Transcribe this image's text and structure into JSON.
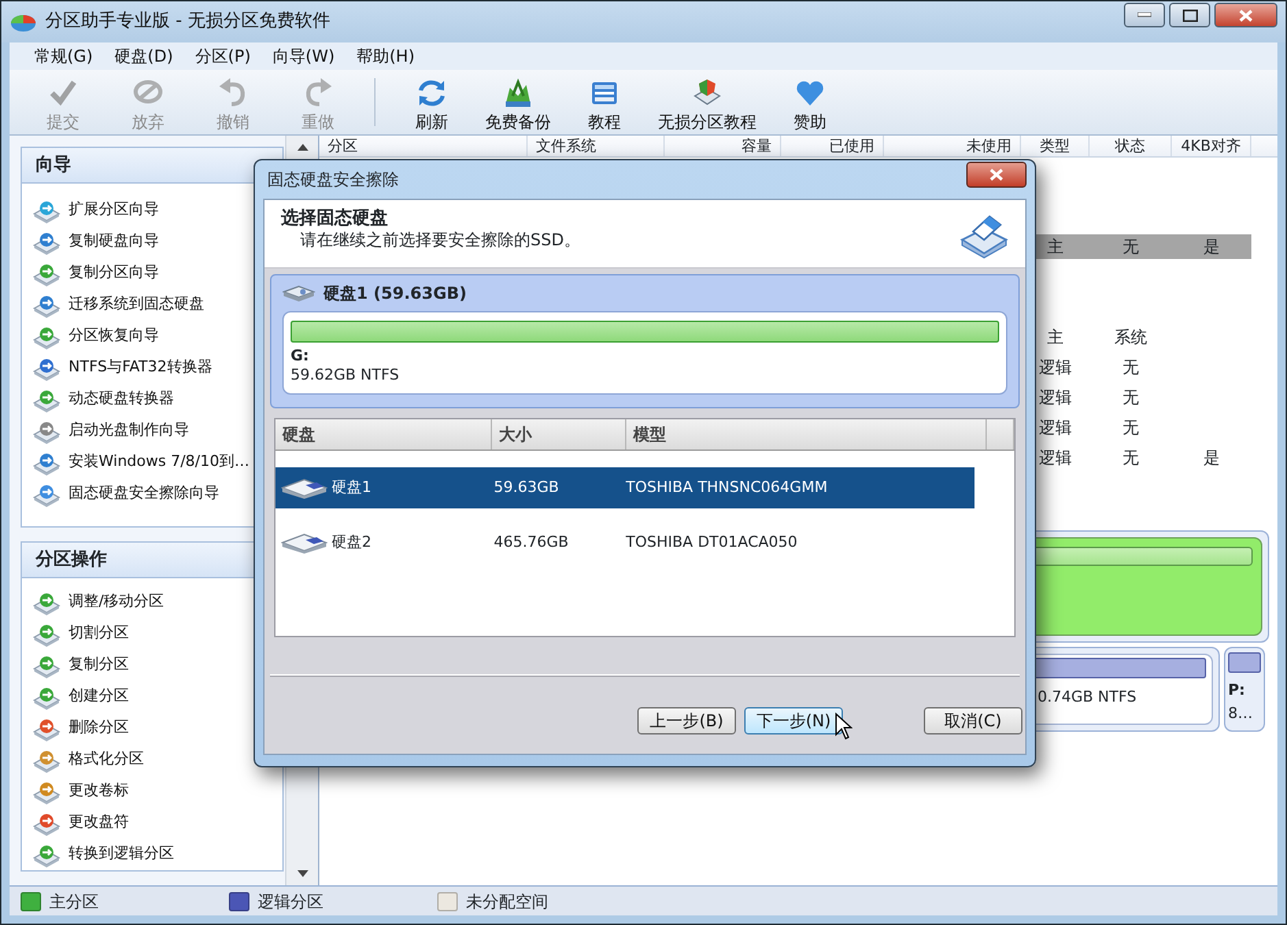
{
  "window": {
    "title": "分区助手专业版 - 无损分区免费软件"
  },
  "menu": [
    "常规(G)",
    "硬盘(D)",
    "分区(P)",
    "向导(W)",
    "帮助(H)"
  ],
  "toolbar": [
    {
      "label": "提交",
      "disabled": true
    },
    {
      "label": "放弃",
      "disabled": true
    },
    {
      "label": "撤销",
      "disabled": true
    },
    {
      "label": "重做",
      "disabled": true
    },
    {
      "label": "刷新",
      "disabled": false
    },
    {
      "label": "免费备份",
      "disabled": false
    },
    {
      "label": "教程",
      "disabled": false
    },
    {
      "label": "无损分区教程",
      "disabled": false
    },
    {
      "label": "赞助",
      "disabled": false
    }
  ],
  "sidebar": {
    "panels": [
      {
        "title": "向导",
        "items": [
          "扩展分区向导",
          "复制硬盘向导",
          "复制分区向导",
          "迁移系统到固态硬盘",
          "分区恢复向导",
          "NTFS与FAT32转换器",
          "动态硬盘转换器",
          "启动光盘制作向导",
          "安装Windows 7/8/10到…",
          "固态硬盘安全擦除向导"
        ]
      },
      {
        "title": "分区操作",
        "items": [
          "调整/移动分区",
          "切割分区",
          "复制分区",
          "创建分区",
          "删除分区",
          "格式化分区",
          "更改卷标",
          "更改盘符",
          "转换到逻辑分区"
        ]
      }
    ]
  },
  "partition_table": {
    "columns": [
      "分区",
      "文件系统",
      "容量",
      "已使用",
      "未使用",
      "类型",
      "状态",
      "4KB对齐"
    ],
    "rows": [
      {
        "selected": true,
        "type": "主",
        "status": "无",
        "align_4kb": "是"
      },
      {
        "selected": false,
        "type": "主",
        "status": "系统"
      },
      {
        "selected": false,
        "type": "逻辑",
        "status": "无"
      },
      {
        "selected": false,
        "type": "逻辑",
        "status": "无"
      },
      {
        "selected": false,
        "type": "逻辑",
        "status": "无"
      },
      {
        "selected": false,
        "type": "逻辑",
        "status": "无",
        "align_4kb": "是"
      }
    ]
  },
  "disk_map": {
    "partition_info": "0.74GB NTFS",
    "small_partition": {
      "letter": "P:",
      "info": "8…"
    }
  },
  "legend": [
    {
      "label": "主分区",
      "color": "#3fb03f"
    },
    {
      "label": "逻辑分区",
      "color": "#4b56b5"
    },
    {
      "label": "未分配空间",
      "color": "#ece8e0"
    }
  ],
  "dialog": {
    "title": "固态硬盘安全擦除",
    "heading": "选择固态硬盘",
    "subtitle": "请在继续之前选择要安全擦除的SSD。",
    "disk": {
      "name": "硬盘1 (59.63GB)",
      "partition": {
        "letter": "G:",
        "info": "59.62GB NTFS"
      }
    },
    "columns": [
      "硬盘",
      "大小",
      "模型"
    ],
    "rows": [
      {
        "disk": "硬盘1",
        "size": "59.63GB",
        "model": "TOSHIBA THNSNC064GMM",
        "selected": true
      },
      {
        "disk": "硬盘2",
        "size": "465.76GB",
        "model": "TOSHIBA DT01ACA050",
        "selected": false
      }
    ],
    "buttons": [
      {
        "label": "上一步(B)",
        "focused": false
      },
      {
        "label": "下一步(N)",
        "focused": true
      },
      {
        "label": "取消(C)",
        "focused": false
      }
    ]
  }
}
